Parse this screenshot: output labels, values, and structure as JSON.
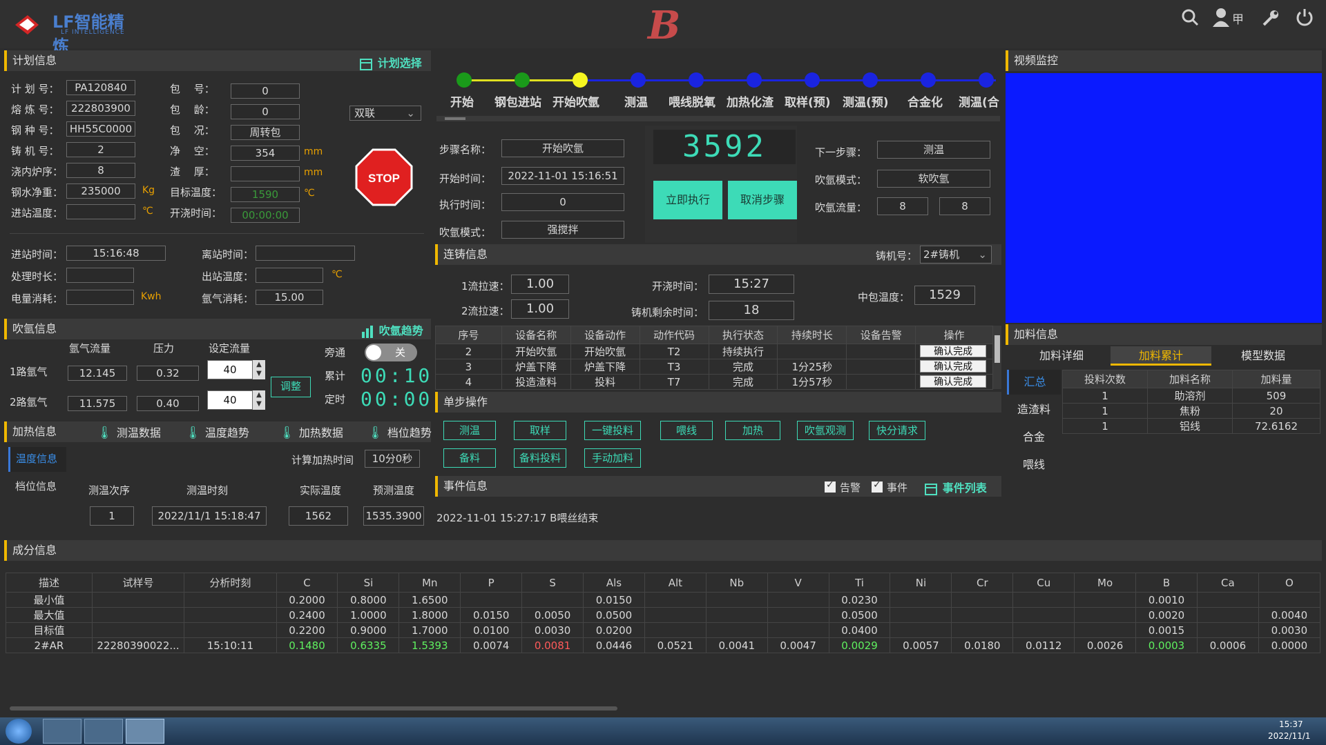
{
  "header": {
    "logo_text": "LF智能精炼",
    "logo_sub": "LF INTELLIGENCE",
    "big_letter": "B",
    "user_label": "甲"
  },
  "plan": {
    "title": "计划信息",
    "select_label": "计划选择",
    "fields": [
      {
        "label": "计 划 号：",
        "value": "PA120840"
      },
      {
        "label": "熔 炼 号：",
        "value": "222803900"
      },
      {
        "label": "钢 种 号：",
        "value": "HH55C0000"
      },
      {
        "label": "铸 机 号：",
        "value": "2"
      },
      {
        "label": "浇内炉序：",
        "value": "8"
      },
      {
        "label": "钢水净重：",
        "value": "235000",
        "unit": "Kg"
      },
      {
        "label": "进站温度：",
        "value": "",
        "unit": "℃"
      }
    ],
    "fields2": [
      {
        "label": "包　 号：",
        "value": "0"
      },
      {
        "label": "包　 龄：",
        "value": "0"
      },
      {
        "label": "包　 况：",
        "value": "周转包"
      },
      {
        "label": "净　 空：",
        "value": "354",
        "unit": "mm"
      },
      {
        "label": "渣　 厚：",
        "value": "",
        "unit": "mm"
      },
      {
        "label": "目标温度：",
        "value": "1590",
        "unit": "℃"
      },
      {
        "label": "开浇时间：",
        "value": "00:00:00"
      }
    ],
    "mode_select": "双联",
    "stop_label": "STOP",
    "enter_time_label": "进站时间：",
    "enter_time": "15:16:48",
    "leave_time_label": "离站时间：",
    "leave_time": "",
    "process_label": "处理时长：",
    "process": "",
    "out_temp_label": "出站温度：",
    "out_temp": "",
    "out_temp_unit": "℃",
    "power_label": "电量消耗：",
    "power": "",
    "power_unit": "Kwh",
    "argon_label": "氩气消耗：",
    "argon": "15.00"
  },
  "argon": {
    "title": "吹氩信息",
    "trend_label": "吹氩趋势",
    "col_flow": "氩气流量",
    "col_pressure": "压力",
    "col_set": "设定流量",
    "rows": [
      {
        "label": "1路氩气",
        "flow": "12.145",
        "pressure": "0.32",
        "set": "40"
      },
      {
        "label": "2路氩气",
        "flow": "11.575",
        "pressure": "0.40",
        "set": "40"
      }
    ],
    "adjust_label": "调整",
    "bypass_label": "旁通",
    "bypass_state": "关",
    "total_label": "累计",
    "total_time": "00:10",
    "timer_label": "定时",
    "timer_time": "00:00"
  },
  "heat": {
    "title": "加热信息",
    "links": [
      "测温数据",
      "温度趋势",
      "加热数据",
      "档位趋势"
    ],
    "side_tabs": [
      "温度信息",
      "档位信息"
    ],
    "calc_label": "计算加热时间",
    "calc_value": "10分0秒",
    "cols": [
      "测温次序",
      "测温时刻",
      "实际温度",
      "预测温度"
    ],
    "row": [
      "1",
      "2022/11/1 15:18:47",
      "1562",
      "1535.3900"
    ]
  },
  "steps": {
    "items": [
      "开始",
      "钢包进站",
      "开始吹氩",
      "测温",
      "喂线脱氧",
      "加热化渣",
      "取样(预)",
      "测温(预)",
      "合金化",
      "测温(合"
    ],
    "name_label": "步骤名称：",
    "name": "开始吹氩",
    "start_label": "开始时间：",
    "start": "2022-11-01 15:16:51",
    "exec_label": "执行时间：",
    "exec": "0",
    "mode_label": "吹氩模式：",
    "mode": "强搅拌",
    "counter": "3592",
    "run_label": "立即执行",
    "cancel_label": "取消步骤",
    "next_label": "下一步骤：",
    "next": "测温",
    "next_mode_label": "吹氩模式：",
    "next_mode": "软吹氩",
    "next_flow_label": "吹氩流量：",
    "next_flow1": "8",
    "next_flow2": "8"
  },
  "caster": {
    "title": "连铸信息",
    "machine_label": "铸机号：",
    "machine": "2#铸机",
    "s1_label": "1流拉速：",
    "s1": "1.00",
    "s2_label": "2流拉速：",
    "s2": "1.00",
    "open_label": "开浇时间：",
    "open": "15:27",
    "remain_label": "铸机剩余时间：",
    "remain": "18",
    "tundish_label": "中包温度：",
    "tundish": "1529"
  },
  "actions": {
    "cols": [
      "序号",
      "设备名称",
      "设备动作",
      "动作代码",
      "执行状态",
      "持续时长",
      "设备告警",
      "操作"
    ],
    "rows": [
      [
        "2",
        "开始吹氩",
        "开始吹氩",
        "T2",
        "持续执行",
        "",
        ""
      ],
      [
        "3",
        "炉盖下降",
        "炉盖下降",
        "T3",
        "完成",
        "1分25秒",
        ""
      ],
      [
        "4",
        "投造渣料",
        "投料",
        "T7",
        "完成",
        "1分57秒",
        ""
      ]
    ],
    "confirm_label": "确认完成"
  },
  "single": {
    "title": "单步操作",
    "row1": [
      "测温",
      "取样",
      "一键投料",
      "喂线",
      "加热",
      "吹氩观测",
      "快分请求"
    ],
    "row2": [
      "备料",
      "备料投料",
      "手动加料"
    ]
  },
  "events": {
    "title": "事件信息",
    "alarm_label": "告警",
    "event_label": "事件",
    "list_label": "事件列表",
    "items": [
      "2022-11-01 15:27:17 B喂丝结束"
    ]
  },
  "video": {
    "title": "视频监控"
  },
  "feed": {
    "title": "加料信息",
    "tabs": [
      "加料详细",
      "加料累计",
      "模型数据"
    ],
    "side": [
      "汇总",
      "造渣料",
      "合金",
      "喂线"
    ],
    "cols": [
      "投料次数",
      "加料名称",
      "加料量"
    ],
    "rows": [
      [
        "1",
        "助溶剂",
        "509"
      ],
      [
        "1",
        "焦粉",
        "20"
      ],
      [
        "1",
        "铝线",
        "72.6162"
      ]
    ]
  },
  "comp": {
    "title": "成分信息",
    "cols": [
      "描述",
      "试样号",
      "分析时刻",
      "C",
      "Si",
      "Mn",
      "P",
      "S",
      "Als",
      "Alt",
      "Nb",
      "V",
      "Ti",
      "Ni",
      "Cr",
      "Cu",
      "Mo",
      "B",
      "Ca",
      "O"
    ],
    "rows": [
      [
        "最小值",
        "",
        "",
        "0.2000",
        "0.8000",
        "1.6500",
        "",
        "",
        "0.0150",
        "",
        "",
        "",
        "0.0230",
        "",
        "",
        "",
        "",
        "0.0010",
        "",
        ""
      ],
      [
        "最大值",
        "",
        "",
        "0.2400",
        "1.0000",
        "1.8000",
        "0.0150",
        "0.0050",
        "0.0500",
        "",
        "",
        "",
        "0.0500",
        "",
        "",
        "",
        "",
        "0.0020",
        "",
        "0.0040"
      ],
      [
        "目标值",
        "",
        "",
        "0.2200",
        "0.9000",
        "1.7000",
        "0.0100",
        "0.0030",
        "0.0200",
        "",
        "",
        "",
        "0.0400",
        "",
        "",
        "",
        "",
        "0.0015",
        "",
        "0.0030"
      ],
      [
        "2#AR",
        "22280390022...",
        "15:10:11",
        "0.1480",
        "0.6335",
        "1.5393",
        "0.0074",
        "0.0081",
        "0.0446",
        "0.0521",
        "0.0041",
        "0.0047",
        "0.0029",
        "0.0057",
        "0.0180",
        "0.0112",
        "0.0026",
        "0.0003",
        "0.0006",
        "0.0000"
      ]
    ]
  },
  "taskbar": {
    "time": "15:37",
    "date": "2022/11/1"
  }
}
